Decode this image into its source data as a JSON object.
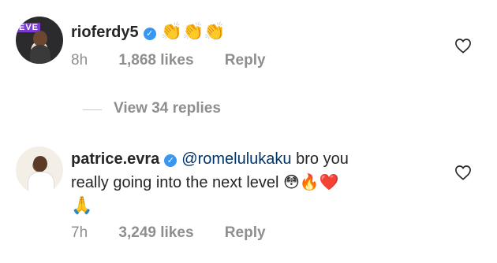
{
  "comments": [
    {
      "username": "rioferdy5",
      "verified_icon": "verified-badge-icon",
      "text": "👏👏👏",
      "time": "8h",
      "likes": "1,868 likes",
      "reply_label": "Reply",
      "avatar_text": "EVE"
    },
    {
      "username": "patrice.evra",
      "verified_icon": "verified-badge-icon",
      "mention": "@romelulukaku",
      "text_line1": "bro you",
      "text_line2": "really going into the next level 😳🔥❤️",
      "text_line3": "🙏",
      "time": "7h",
      "likes": "3,249 likes",
      "reply_label": "Reply"
    }
  ],
  "view_replies": "View 34 replies",
  "colors": {
    "verified": "#3897f0",
    "mention": "#003569",
    "meta": "#8e8e8e"
  }
}
